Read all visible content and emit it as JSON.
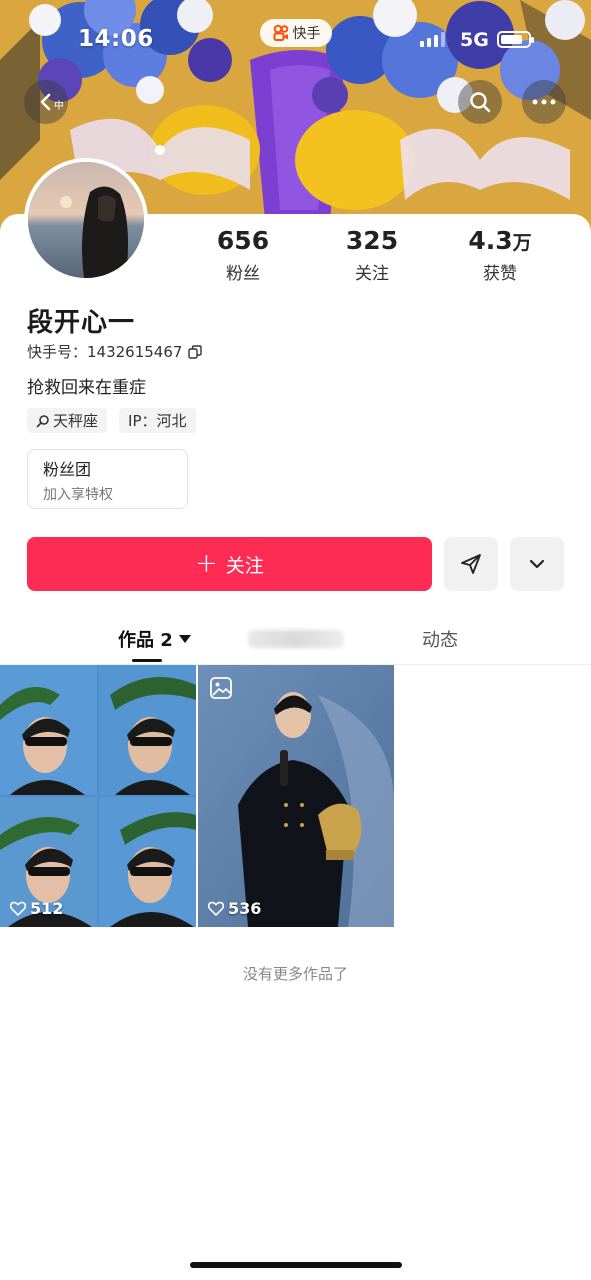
{
  "status_bar": {
    "time": "14:06",
    "network": "5G",
    "app_badge": "快手"
  },
  "header": {
    "back_hint": "中"
  },
  "profile": {
    "name": "段开心一",
    "uid_label": "快手号：1432615467",
    "bio": "抢救回来在重症",
    "tags": [
      {
        "icon": "search-icon",
        "label": "天秤座"
      },
      {
        "icon": "",
        "label": "IP：河北"
      }
    ],
    "stats": [
      {
        "value": "656",
        "unit": "",
        "label": "粉丝"
      },
      {
        "value": "325",
        "unit": "",
        "label": "关注"
      },
      {
        "value": "4.3",
        "unit": "万",
        "label": "获赞"
      }
    ],
    "fan_club": {
      "title": "粉丝团",
      "subtitle": "加入享特权"
    }
  },
  "actions": {
    "follow_label": "关注",
    "plus_symbol": "+"
  },
  "tabs": [
    {
      "label": "作品 2",
      "active": true
    },
    {
      "label": "动态",
      "active": false
    }
  ],
  "works": [
    {
      "likes": "512",
      "type": "collage"
    },
    {
      "likes": "536",
      "type": "image"
    }
  ],
  "footer": {
    "no_more": "没有更多作品了"
  },
  "colors": {
    "accent": "#fe2c55",
    "brand": "#ff5000"
  }
}
